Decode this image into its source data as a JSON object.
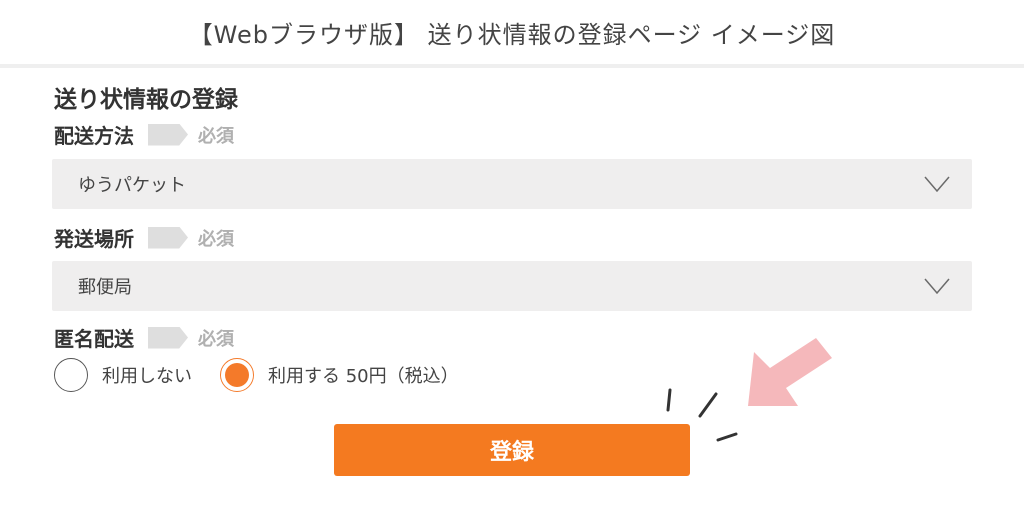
{
  "caption": "【Webブラウザ版】 送り状情報の登録ページ イメージ図",
  "form": {
    "title": "送り状情報の登録",
    "required_text": "必須",
    "fields": [
      {
        "label": "配送方法",
        "value": "ゆうパケット",
        "icon": "chevron-down-icon"
      },
      {
        "label": "発送場所",
        "value": "郵便局",
        "icon": "chevron-down-icon"
      }
    ],
    "anonymous": {
      "label": "匿名配送",
      "options": [
        {
          "label": "利用しない",
          "selected": false
        },
        {
          "label": "利用する 50円（税込）",
          "selected": true
        }
      ]
    },
    "submit_label": "登録"
  },
  "colors": {
    "accent": "#f47a20",
    "select_bg": "#efeeee",
    "required_tag": "#dedede",
    "pointer_arrow": "#f5b8bb"
  },
  "icons": {
    "pointer": "pointer-arrow-icon",
    "emphasis": "burst-lines-icon",
    "tag": "required-tag-icon"
  }
}
